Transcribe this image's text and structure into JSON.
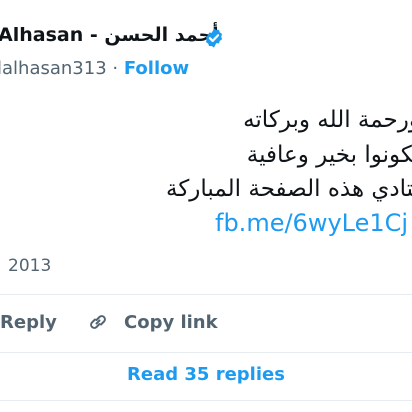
{
  "author": {
    "display_name": "Alhasan - أحمد الحسن",
    "handle": "lalhasan313",
    "separator": "·",
    "follow_label": "Follow"
  },
  "tweet": {
    "lines": [
      "ورحمة الله وبركاته",
      "تكونوا بخير وعافية",
      "بتادي هذه الصفحة المباركة"
    ],
    "link_text": "fb.me/6wyLe1Cj",
    "timestamp": "2013"
  },
  "actions": {
    "reply_label": "Reply",
    "copy_link_label": "Copy link",
    "read_replies_label": "Read 35 replies"
  },
  "icons": {
    "verified": "verified-badge-icon",
    "link": "link-icon"
  },
  "colors": {
    "accent": "#1d9bf0",
    "text_primary": "#0f1419",
    "text_secondary": "#536471",
    "divider": "#e6ecf0"
  }
}
